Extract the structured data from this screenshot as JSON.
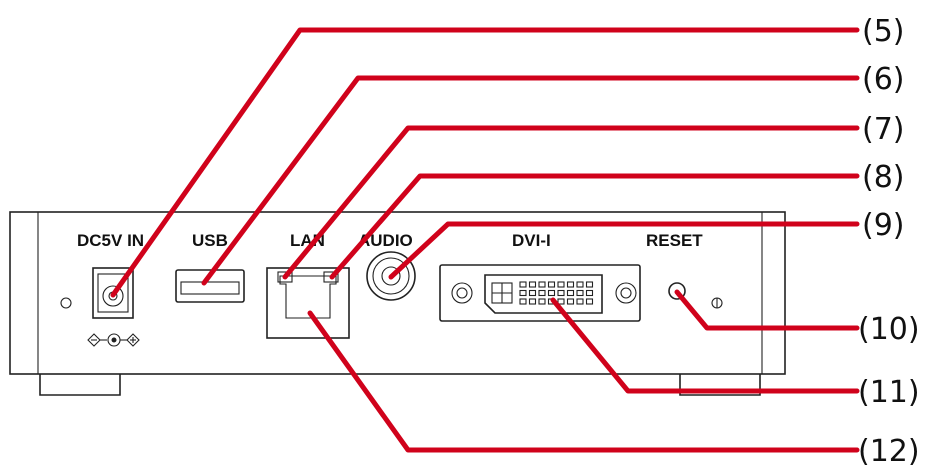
{
  "panel_labels": {
    "dc_in": "DC5V IN",
    "usb": "USB",
    "lan": "LAN",
    "audio": "AUDIO",
    "dvi": "DVI-I",
    "reset": "RESET"
  },
  "callouts": [
    {
      "id": "c5",
      "label": "(5)"
    },
    {
      "id": "c6",
      "label": "(6)"
    },
    {
      "id": "c7",
      "label": "(7)"
    },
    {
      "id": "c8",
      "label": "(8)"
    },
    {
      "id": "c9",
      "label": "(9)"
    },
    {
      "id": "c10",
      "label": "(10)"
    },
    {
      "id": "c11",
      "label": "(11)"
    },
    {
      "id": "c12",
      "label": "(12)"
    }
  ],
  "colors": {
    "leader": "#d0021b",
    "outline": "#222222"
  }
}
